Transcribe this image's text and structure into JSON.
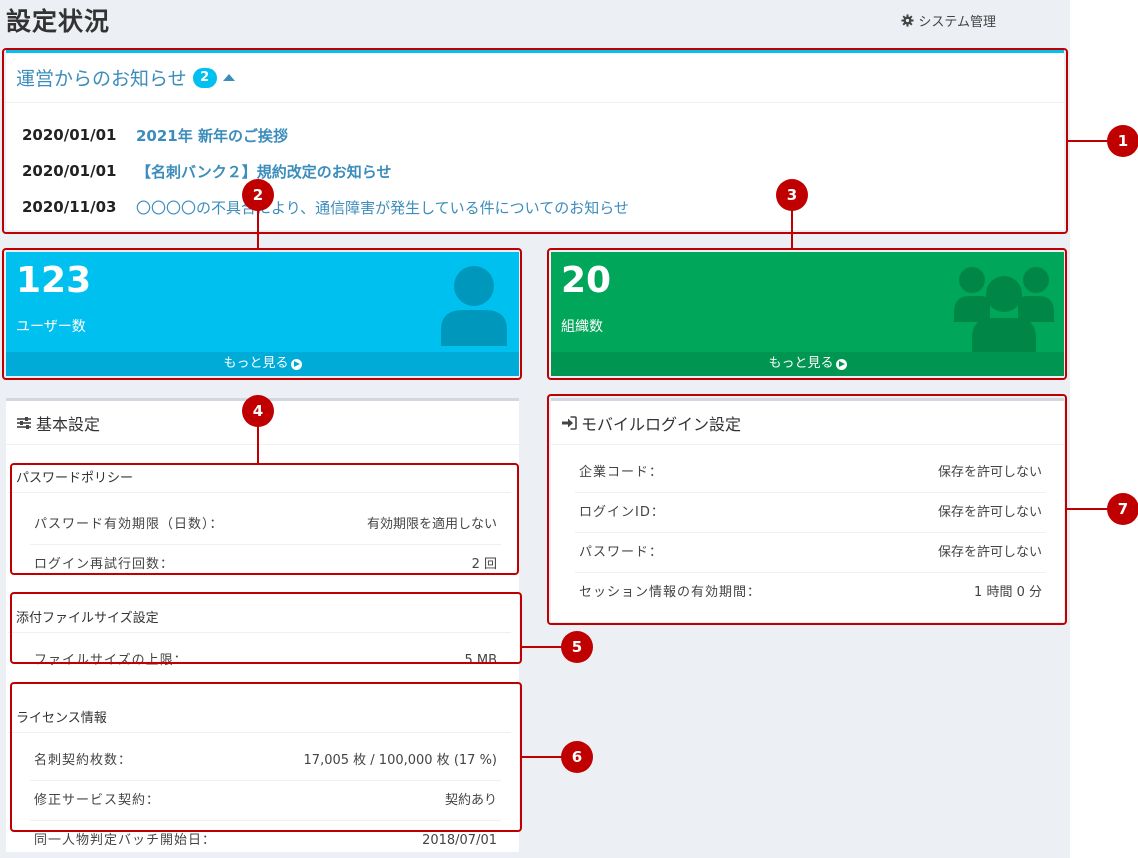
{
  "page": {
    "title": "設定状況",
    "system_admin": "システム管理"
  },
  "notices": {
    "title": "運営からのお知らせ",
    "count": "2",
    "items": [
      {
        "date": "2020/01/01",
        "text": "2021年 新年のご挨拶"
      },
      {
        "date": "2020/01/01",
        "text": "【名刺バンク２】規約改定のお知らせ"
      },
      {
        "date": "2020/11/03",
        "text": "〇〇〇〇の不具合により、通信障害が発生している件についてのお知らせ"
      }
    ]
  },
  "stats": {
    "users": {
      "value": "123",
      "label": "ユーザー数",
      "more": "もっと見る"
    },
    "orgs": {
      "value": "20",
      "label": "組織数",
      "more": "もっと見る"
    }
  },
  "basic": {
    "title": "基本設定",
    "password": {
      "title": "パスワードポリシー",
      "rows": [
        {
          "label": "パスワード有効期限（日数）：",
          "value": "有効期限を適用しない"
        },
        {
          "label": "ログイン再試行回数：",
          "value": "2 回"
        }
      ]
    },
    "file": {
      "title": "添付ファイルサイズ設定",
      "rows": [
        {
          "label": "ファイルサイズの上限：",
          "value": "5 MB"
        }
      ]
    },
    "license": {
      "title": "ライセンス情報",
      "rows": [
        {
          "label": "名刺契約枚数：",
          "value": "17,005 枚 / 100,000 枚 (17 %)"
        },
        {
          "label": "修正サービス契約：",
          "value": "契約あり"
        },
        {
          "label": "同一人物判定バッチ開始日：",
          "value": "2018/07/01"
        }
      ]
    }
  },
  "mobile": {
    "title": "モバイルログイン設定",
    "rows": [
      {
        "label": "企業コード：",
        "value": "保存を許可しない"
      },
      {
        "label": "ログインID：",
        "value": "保存を許可しない"
      },
      {
        "label": "パスワード：",
        "value": "保存を許可しない"
      },
      {
        "label": "セッション情報の有効期間：",
        "value": "1 時間 0 分"
      }
    ]
  },
  "annotations": [
    "1",
    "2",
    "3",
    "4",
    "5",
    "6",
    "7"
  ],
  "colors": {
    "aqua": "#00c0ef",
    "green": "#00a65a",
    "link": "#3c8dbc",
    "annotation": "#c00000"
  }
}
